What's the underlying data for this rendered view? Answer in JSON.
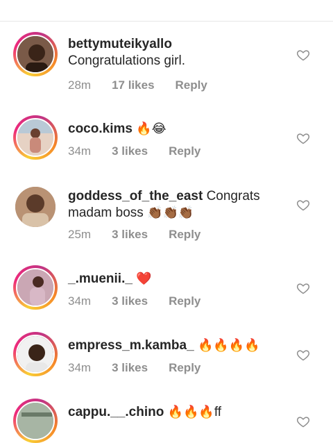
{
  "comments": [
    {
      "username": "bettymuteikyallo",
      "text": "Congratulations girl.",
      "emoji": "",
      "time": "28m",
      "likes": "17 likes",
      "reply": "Reply",
      "avatar_bg": "#6b4a3a",
      "ring": true
    },
    {
      "username": "coco.kims",
      "text": "",
      "emoji": "🔥😂",
      "time": "34m",
      "likes": "3 likes",
      "reply": "Reply",
      "avatar_bg": "#c9a28e",
      "ring": true
    },
    {
      "username": "goddess_of_the_east",
      "text": "Congrats madam boss",
      "emoji": "👏🏾👏🏾👏🏾",
      "time": "25m",
      "likes": "3 likes",
      "reply": "Reply",
      "avatar_bg": "#a88066",
      "ring": false
    },
    {
      "username": "_.muenii._",
      "text": "",
      "emoji": "❤️",
      "time": "34m",
      "likes": "3 likes",
      "reply": "Reply",
      "avatar_bg": "#b58a9c",
      "ring": true
    },
    {
      "username": "empress_m.kamba_",
      "text": "",
      "emoji": "🔥🔥🔥🔥",
      "time": "34m",
      "likes": "3 likes",
      "reply": "Reply",
      "avatar_bg": "#5a4a44",
      "ring": true
    },
    {
      "username": "cappu.__.chino",
      "text": "ff",
      "emoji": "🔥🔥🔥",
      "time": "",
      "likes": "",
      "reply": "",
      "avatar_bg": "#8a9a88",
      "ring": true
    }
  ],
  "icons": {
    "like": "heart-outline-icon"
  },
  "colors": {
    "meta": "#8e8e8e",
    "text": "#262626",
    "ring_from": "#f9ce34",
    "ring_to": "#ee2a7b"
  }
}
